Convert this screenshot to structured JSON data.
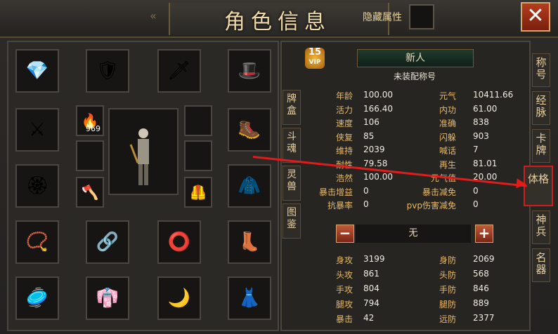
{
  "window": {
    "title": "角色信息",
    "hide_attr_label": "隐藏属性",
    "close_symbol": "✕"
  },
  "equipment": {
    "count_label": "969",
    "slots": [
      {
        "name": "gem-icon",
        "glyph": "💎"
      },
      {
        "name": "armor-icon",
        "glyph": "🛡"
      },
      {
        "name": "bracer-icon",
        "glyph": "🗡"
      },
      {
        "name": "hat-icon",
        "glyph": "🎩"
      },
      {
        "name": "spear-icon",
        "glyph": "⚔"
      },
      {
        "name": "torch-icon",
        "glyph": "🔥"
      },
      {
        "name": "leg-guard-icon",
        "glyph": "🥾"
      },
      {
        "name": "emblem-icon",
        "glyph": "🏵"
      },
      {
        "name": "axe-icon",
        "glyph": "🪓"
      },
      {
        "name": "cloak-icon",
        "glyph": "🧥"
      },
      {
        "name": "necklace-icon",
        "glyph": "📿"
      },
      {
        "name": "pendant-icon",
        "glyph": "🔗"
      },
      {
        "name": "ring-icon",
        "glyph": "⭕"
      },
      {
        "name": "boots-icon",
        "glyph": "👢"
      },
      {
        "name": "disc-icon",
        "glyph": "🥏"
      },
      {
        "name": "robe-icon",
        "glyph": "👘"
      },
      {
        "name": "blade-icon",
        "glyph": "🌙"
      },
      {
        "name": "costume-icon",
        "glyph": "👗"
      },
      {
        "name": "small-armor-icon",
        "glyph": "🦺"
      }
    ]
  },
  "profile": {
    "vip_level": "15",
    "vip_label": "VIP",
    "name": "新人",
    "title": "未装配称号"
  },
  "left_tabs": [
    "牌盒",
    "斗魂",
    "灵兽",
    "图鉴"
  ],
  "right_tabs": [
    "称号",
    "经脉",
    "卡牌",
    "体格",
    "神兵",
    "名器"
  ],
  "attributes_top": [
    {
      "label": "年龄",
      "value": "100.00"
    },
    {
      "label": "元气",
      "value": "10411.66"
    },
    {
      "label": "活力",
      "value": "166.40"
    },
    {
      "label": "内功",
      "value": "61.00"
    },
    {
      "label": "速度",
      "value": "106"
    },
    {
      "label": "准确",
      "value": "838"
    },
    {
      "label": "侠复",
      "value": "85"
    },
    {
      "label": "闪躲",
      "value": "903"
    },
    {
      "label": "维持",
      "value": "2039"
    },
    {
      "label": "喊话",
      "value": "7"
    },
    {
      "label": "耐性",
      "value": "79.58"
    },
    {
      "label": "再生",
      "value": "81.01"
    },
    {
      "label": "浩然",
      "value": "100.00"
    },
    {
      "label": "元气值",
      "value": "20.00"
    },
    {
      "label": "暴击增益",
      "value": "0"
    },
    {
      "label": "暴击减免",
      "value": "0"
    },
    {
      "label": "抗暴率",
      "value": "0"
    },
    {
      "label": "pvp伤害减免",
      "value": "0"
    }
  ],
  "selector": {
    "minus": "−",
    "value": "无",
    "plus": "+"
  },
  "attributes_bottom": [
    {
      "label": "身攻",
      "value": "3199"
    },
    {
      "label": "身防",
      "value": "2069"
    },
    {
      "label": "头攻",
      "value": "861"
    },
    {
      "label": "头防",
      "value": "568"
    },
    {
      "label": "手攻",
      "value": "804"
    },
    {
      "label": "手防",
      "value": "846"
    },
    {
      "label": "腿攻",
      "value": "794"
    },
    {
      "label": "腿防",
      "value": "889"
    },
    {
      "label": "暴击",
      "value": "42"
    },
    {
      "label": "远防",
      "value": "2377"
    }
  ],
  "colors": {
    "accent": "#e8b96a",
    "annotation": "#e21b1b"
  }
}
